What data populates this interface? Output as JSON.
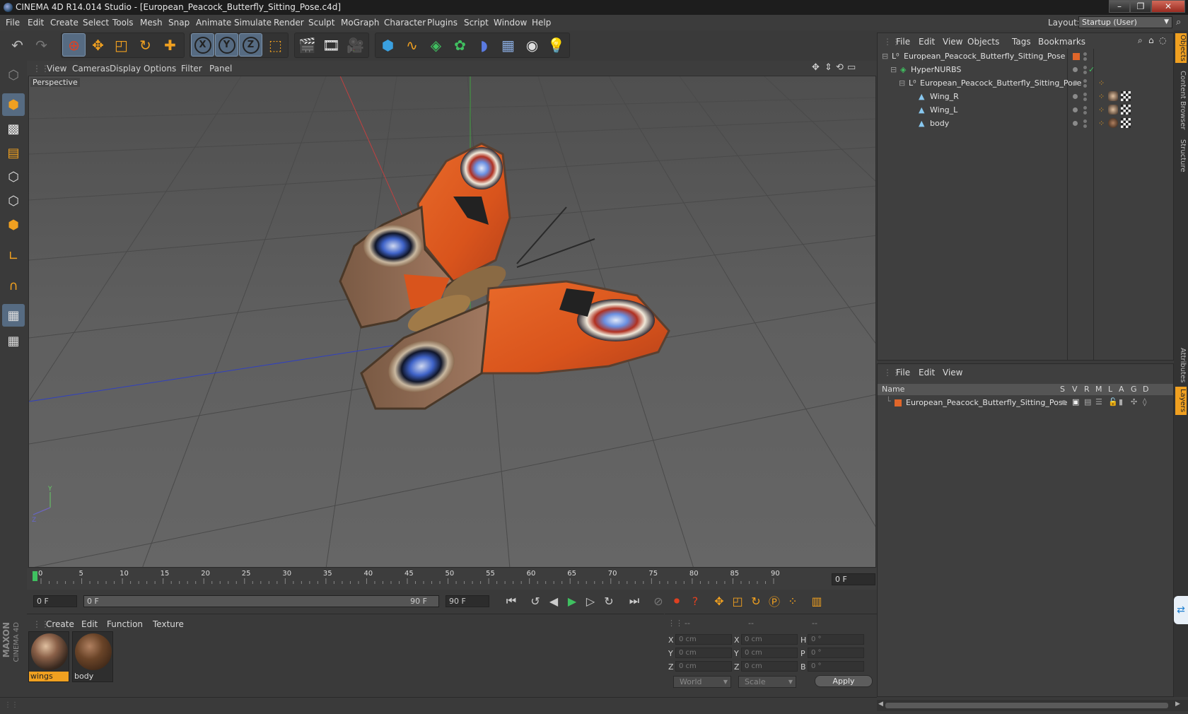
{
  "window": {
    "title": "CINEMA 4D R14.014 Studio - [European_Peacock_Butterfly_Sitting_Pose.c4d]",
    "minimize": "–",
    "maximize": "❐",
    "close": "✕"
  },
  "menubar": {
    "items": [
      "File",
      "Edit",
      "Create",
      "Select",
      "Tools",
      "Mesh",
      "Snap",
      "Animate",
      "Simulate",
      "Render",
      "Sculpt",
      "MoGraph",
      "Character",
      "Plugins",
      "Script",
      "Window",
      "Help"
    ],
    "layout_label": "Layout:",
    "layout_value": "Startup (User)"
  },
  "toolbar": {
    "icons": [
      "undo-icon",
      "redo-icon",
      "live-selection-icon",
      "move-icon",
      "scale-icon",
      "rotate-icon",
      "add-icon",
      "x-axis-icon",
      "y-axis-icon",
      "z-axis-icon",
      "coordinate-system-icon",
      "render-view-icon",
      "render-picture-viewer-icon",
      "edit-render-settings-icon",
      "cube-icon",
      "spline-icon",
      "nurbs-icon",
      "array-icon",
      "deformer-icon",
      "floor-icon",
      "camera-icon",
      "light-icon"
    ],
    "axis_labels": [
      "X",
      "Y",
      "Z"
    ]
  },
  "viewport": {
    "menus": [
      "View",
      "Cameras",
      "Display",
      "Options",
      "Filter",
      "Panel"
    ],
    "label": "Perspective"
  },
  "timeline": {
    "ticks": [
      "0",
      "5",
      "10",
      "15",
      "20",
      "25",
      "30",
      "35",
      "40",
      "45",
      "50",
      "55",
      "60",
      "65",
      "70",
      "75",
      "80",
      "85",
      "90"
    ],
    "current_frame": "0 F"
  },
  "transport": {
    "start_frame": "0 F",
    "range_start": "0 F",
    "range_end": "90 F",
    "end_frame": "90 F"
  },
  "materials": {
    "menus": [
      "Create",
      "Edit",
      "Function",
      "Texture"
    ],
    "items": [
      {
        "name": "wings",
        "selected": true
      },
      {
        "name": "body",
        "selected": false
      }
    ]
  },
  "coordinates": {
    "headers": [
      "--",
      "--",
      "--"
    ],
    "rows": [
      {
        "pos_label": "X",
        "pos": "0 cm",
        "size_label": "X",
        "size": "0 cm",
        "rot_label": "H",
        "rot": "0 °"
      },
      {
        "pos_label": "Y",
        "pos": "0 cm",
        "size_label": "Y",
        "size": "0 cm",
        "rot_label": "P",
        "rot": "0 °"
      },
      {
        "pos_label": "Z",
        "pos": "0 cm",
        "size_label": "Z",
        "size": "0 cm",
        "rot_label": "B",
        "rot": "0 °"
      }
    ],
    "mode": "World",
    "transform": "Scale",
    "apply": "Apply"
  },
  "object_manager": {
    "menus": [
      "File",
      "Edit",
      "View",
      "Objects",
      "Tags",
      "Bookmarks"
    ],
    "objects": [
      {
        "name": "European_Peacock_Butterfly_Sitting_Pose",
        "indent": 0,
        "icon": "null-icon"
      },
      {
        "name": "HyperNURBS",
        "indent": 1,
        "icon": "hypernurbs-icon"
      },
      {
        "name": "European_Peacock_Butterfly_Sitting_Pose",
        "indent": 2,
        "icon": "null-icon"
      },
      {
        "name": "Wing_R",
        "indent": 3,
        "icon": "polygon-icon"
      },
      {
        "name": "Wing_L",
        "indent": 3,
        "icon": "polygon-icon"
      },
      {
        "name": "body",
        "indent": 3,
        "icon": "polygon-icon"
      }
    ]
  },
  "layer_manager": {
    "menus": [
      "File",
      "Edit",
      "View"
    ],
    "columns": [
      "Name",
      "S",
      "V",
      "R",
      "M",
      "L",
      "A",
      "G",
      "D"
    ],
    "layers": [
      {
        "name": "European_Peacock_Butterfly_Sitting_Pose",
        "color": "#e0662a"
      }
    ]
  },
  "right_tabs": [
    "Objects",
    "Content Browser",
    "Structure",
    "Attributes",
    "Layers"
  ],
  "brand": {
    "line1": "MAXON",
    "line2": "CINEMA 4D"
  },
  "colors": {
    "accent": "#566b82",
    "highlight": "#f0a020",
    "layer": "#e0662a"
  }
}
